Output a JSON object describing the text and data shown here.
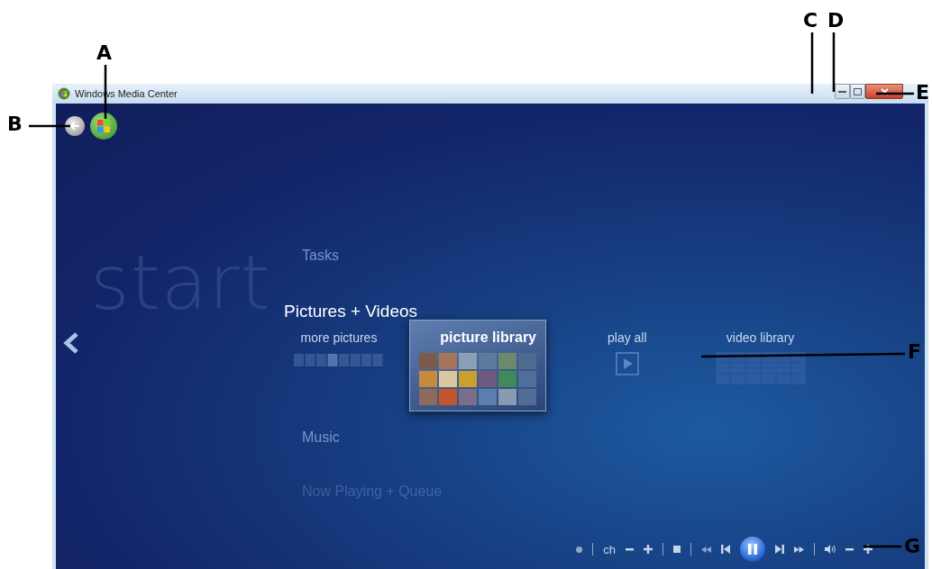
{
  "window": {
    "title": "Windows Media Center"
  },
  "menu": {
    "background_label": "start",
    "categories": [
      {
        "label": "Tasks",
        "selected": false
      },
      {
        "label": "Pictures + Videos",
        "selected": true,
        "items": [
          {
            "label": "more pictures",
            "kind": "strip",
            "selected": false
          },
          {
            "label": "picture library",
            "kind": "thumbnails",
            "selected": true
          },
          {
            "label": "play all",
            "kind": "play",
            "selected": false
          },
          {
            "label": "video library",
            "kind": "grid",
            "selected": false
          }
        ]
      },
      {
        "label": "Music",
        "selected": false
      },
      {
        "label": "Now Playing + Queue",
        "selected": false
      }
    ]
  },
  "transport": [
    {
      "kind": "record"
    },
    {
      "kind": "sep"
    },
    {
      "kind": "text",
      "label": "ch"
    },
    {
      "kind": "minus"
    },
    {
      "kind": "plus"
    },
    {
      "kind": "sep"
    },
    {
      "kind": "stop"
    },
    {
      "kind": "sep"
    },
    {
      "kind": "rewind"
    },
    {
      "kind": "prev"
    },
    {
      "kind": "pause"
    },
    {
      "kind": "next"
    },
    {
      "kind": "ffwd"
    },
    {
      "kind": "sep"
    },
    {
      "kind": "volume"
    },
    {
      "kind": "minus"
    },
    {
      "kind": "plus"
    }
  ],
  "callouts": [
    {
      "letter": "A"
    },
    {
      "letter": "B"
    },
    {
      "letter": "C"
    },
    {
      "letter": "D"
    },
    {
      "letter": "E"
    },
    {
      "letter": "F"
    },
    {
      "letter": "G"
    }
  ]
}
